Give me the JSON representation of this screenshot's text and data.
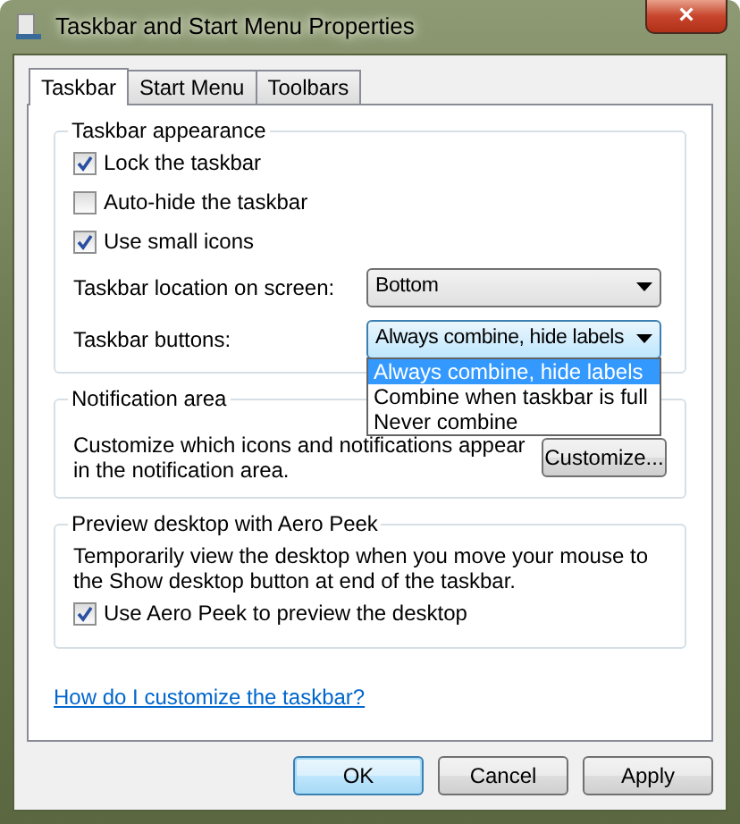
{
  "window": {
    "title": "Taskbar and Start Menu Properties",
    "close": "×"
  },
  "tabs": [
    {
      "label": "Taskbar",
      "selected": true
    },
    {
      "label": "Start Menu",
      "selected": false
    },
    {
      "label": "Toolbars",
      "selected": false
    }
  ],
  "groups": [
    {
      "title": "Taskbar appearance",
      "items": [
        {
          "kind": "checkbox",
          "label": "Lock the taskbar",
          "checked": true
        },
        {
          "kind": "checkbox",
          "label": "Auto-hide the taskbar",
          "checked": false
        },
        {
          "kind": "checkbox",
          "label": "Use small icons",
          "checked": true
        },
        {
          "kind": "select",
          "label": "Taskbar location on screen:",
          "value": "Bottom",
          "open": false
        },
        {
          "kind": "select",
          "label": "Taskbar buttons:",
          "value": "Always combine, hide labels",
          "open": true,
          "options": [
            {
              "label": "Always combine, hide labels",
              "selected": true
            },
            {
              "label": "Combine when taskbar is full",
              "selected": false
            },
            {
              "label": "Never combine",
              "selected": false
            }
          ]
        }
      ]
    },
    {
      "title": "Notification area",
      "items": [
        {
          "kind": "text_button",
          "text": "Customize which icons and notifications appear in the notification area.",
          "button": "Customize..."
        }
      ]
    },
    {
      "title": "Preview desktop with Aero Peek",
      "items": [
        {
          "kind": "text",
          "text": "Temporarily view the desktop when you move your mouse to the Show desktop button at end of the taskbar."
        },
        {
          "kind": "checkbox",
          "label": "Use Aero Peek to preview the desktop",
          "checked": true
        }
      ]
    }
  ],
  "help_link": "How do I customize the taskbar?",
  "buttons": [
    {
      "label": "OK",
      "default": true
    },
    {
      "label": "Cancel",
      "default": false
    },
    {
      "label": "Apply",
      "default": false
    }
  ]
}
